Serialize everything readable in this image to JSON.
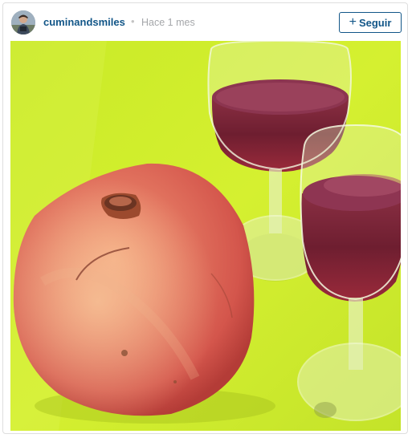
{
  "post": {
    "username": "cuminandsmiles",
    "separator": "•",
    "timestamp": "Hace 1 mes",
    "follow_button": {
      "icon": "plus-icon",
      "label": "Seguir",
      "color": "#125688"
    },
    "photo": {
      "subject": "pomegranate-and-juice-glasses",
      "background_color": "#d2f02a"
    }
  }
}
